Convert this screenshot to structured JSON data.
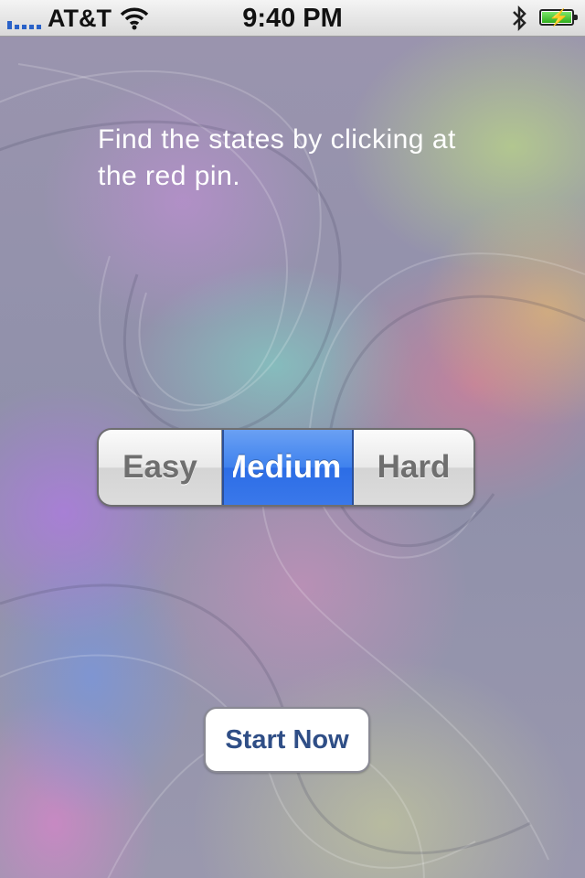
{
  "status_bar": {
    "carrier": "AT&T",
    "time": "9:40 PM",
    "icons": [
      "signal-icon",
      "wifi-icon",
      "bluetooth-icon",
      "battery-charging-icon"
    ]
  },
  "main": {
    "instructions": "Find the states by clicking at the red pin.",
    "difficulty": {
      "options": [
        "Easy",
        "Medium",
        "Hard"
      ],
      "selected": "Medium"
    },
    "start_button": "Start Now"
  },
  "colors": {
    "selected_segment": "#3f82ee",
    "start_button_text": "#2f4e86"
  }
}
